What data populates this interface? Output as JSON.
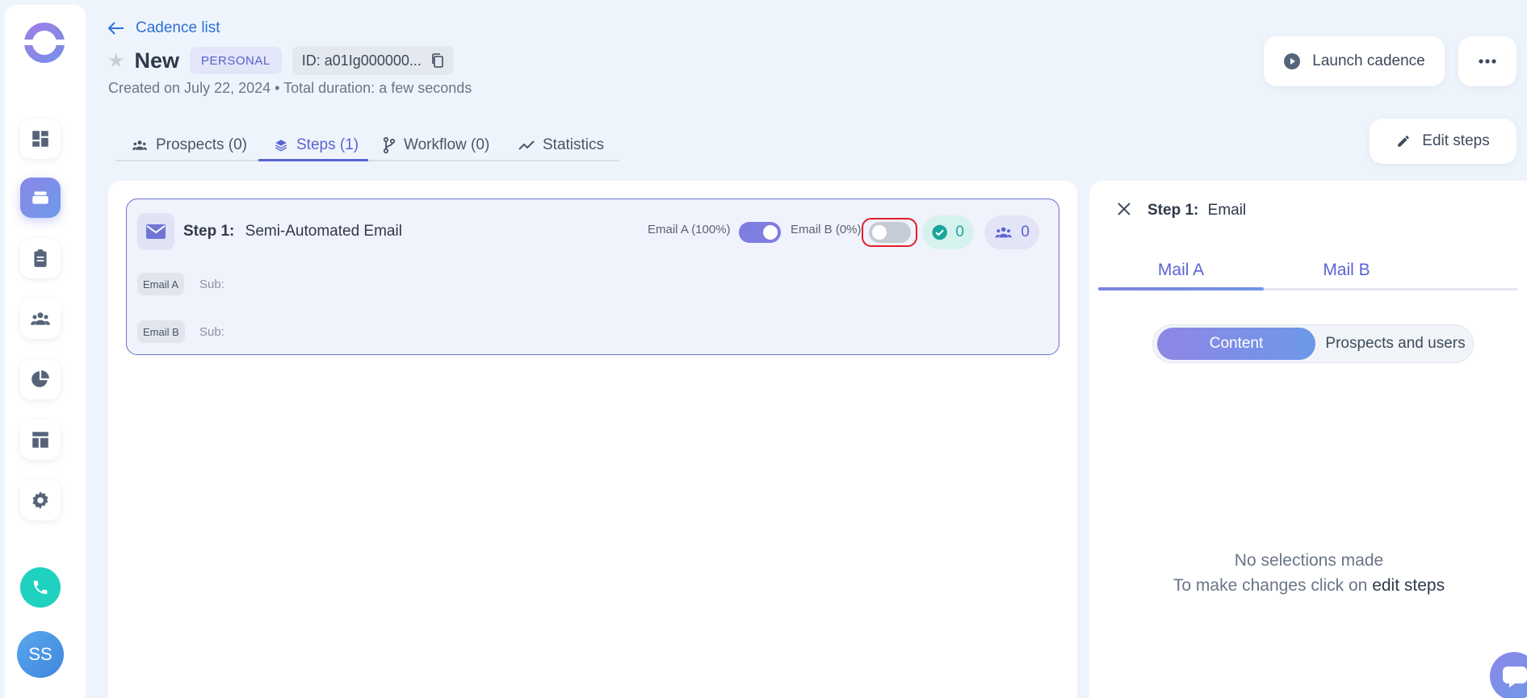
{
  "nav": {
    "back_label": "Cadence list"
  },
  "header": {
    "title": "New",
    "badge": "PERSONAL",
    "id_label": "ID: a01Ig000000...",
    "subtitle": "Created on July 22, 2024 • Total duration: a few seconds",
    "launch_label": "Launch cadence",
    "edit_steps_label": "Edit steps"
  },
  "tabs": [
    {
      "label": "Prospects (0)",
      "icon": "people-icon"
    },
    {
      "label": "Steps (1)",
      "icon": "layers-icon",
      "active": true
    },
    {
      "label": "Workflow (0)",
      "icon": "branch-icon"
    },
    {
      "label": "Statistics",
      "icon": "trend-icon"
    }
  ],
  "step": {
    "number_label": "Step 1:",
    "name": "Semi-Automated Email",
    "email_a_label": "Email A (100%)",
    "email_a_enabled": true,
    "email_b_label": "Email B (0%)",
    "email_b_enabled": false,
    "done_count": "0",
    "people_count": "0",
    "rows": [
      {
        "tag": "Email A",
        "sub_label": "Sub:"
      },
      {
        "tag": "Email B",
        "sub_label": "Sub:"
      }
    ]
  },
  "side_panel": {
    "title_prefix": "Step 1:",
    "title": "Email",
    "mail_tabs": [
      "Mail A",
      "Mail B"
    ],
    "segments": [
      "Content",
      "Prospects and users"
    ],
    "empty_line1": "No selections made",
    "empty_line2_prefix": "To make changes click on",
    "empty_line2_link": "edit steps"
  },
  "user": {
    "initials": "SS"
  },
  "colors": {
    "accent": "#5b63d3",
    "link": "#2f6fd8",
    "phone": "#1fd1bf",
    "focus_ring": "#e0202a"
  }
}
